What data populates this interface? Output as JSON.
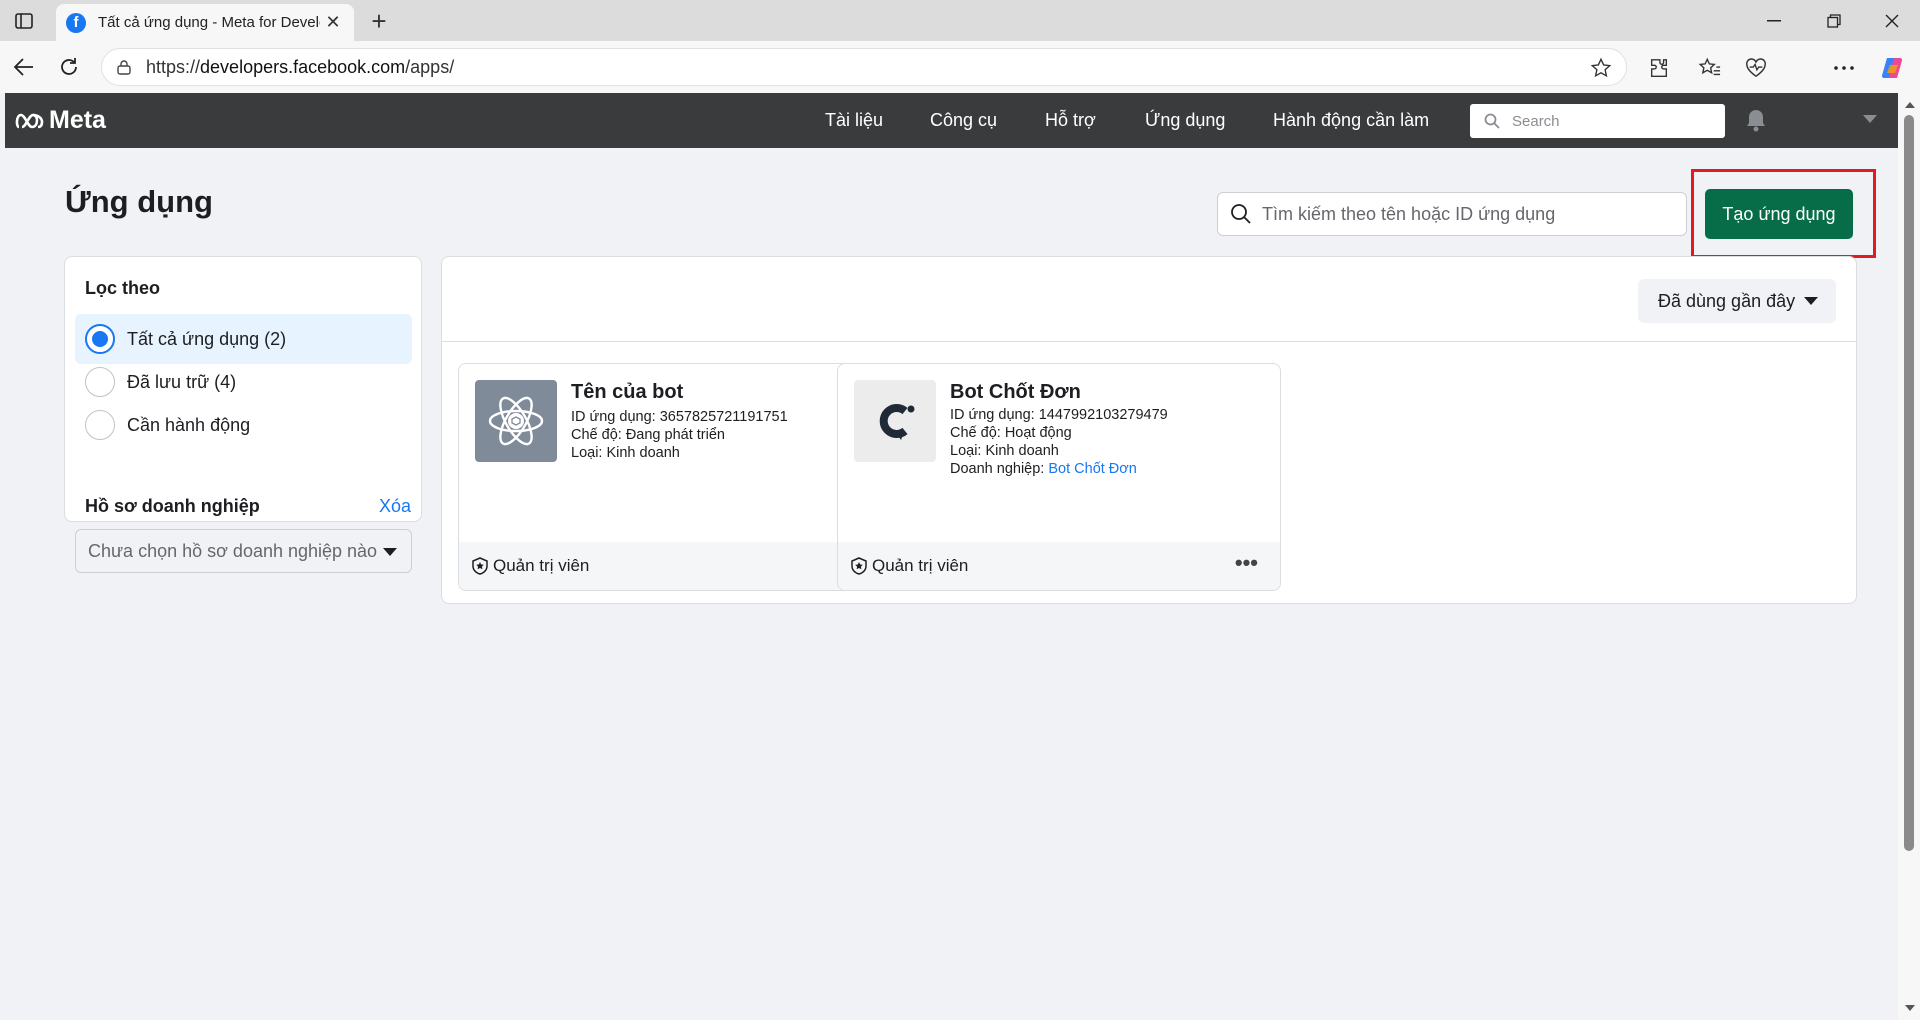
{
  "browser": {
    "tab_title": "Tất cả ứng dụng - Meta for Developers",
    "url_prefix": "https://",
    "url_host": "developers.facebook.com",
    "url_path": "/apps/"
  },
  "header": {
    "logo_text": "Meta",
    "nav": [
      "Tài liệu",
      "Công cụ",
      "Hỗ trợ",
      "Ứng dụng",
      "Hành động cần làm"
    ],
    "search_placeholder": "Search"
  },
  "page": {
    "title": "Ứng dụng",
    "search_placeholder": "Tìm kiếm theo tên hoặc ID ứng dụng",
    "create_button": "Tạo ứng dụng"
  },
  "filters": {
    "heading": "Lọc theo",
    "options": [
      "Tất cả ứng dụng (2)",
      "Đã lưu trữ (4)",
      "Cần hành động"
    ],
    "selected_index": 0,
    "business_heading": "Hồ sơ doanh nghiệp",
    "business_clear": "Xóa",
    "business_placeholder": "Chưa chọn hồ sơ doanh nghiệp nào"
  },
  "sort": {
    "label": "Đã dùng gần đây"
  },
  "apps": [
    {
      "name": "Tên của bot",
      "id_line": "ID ứng dụng: 3657825721191751",
      "mode_line": "Chế độ: Đang phát triển",
      "type_line": "Loại: Kinh doanh",
      "role": "Quản trị viên",
      "icon": "atom-icon"
    },
    {
      "name": "Bot Chốt Đơn",
      "id_line": "ID ứng dụng: 1447992103279479",
      "mode_line": "Chế độ: Hoạt động",
      "type_line": "Loại: Kinh doanh",
      "business_prefix": "Doanh nghiệp: ",
      "business_link": "Bot Chốt Đơn",
      "role": "Quản trị viên",
      "icon": "c-logo-icon"
    }
  ],
  "colors": {
    "create_button_bg": "#076c48",
    "highlight_border": "#e11b22",
    "accent": "#1877f2",
    "header_bg": "#3a3b3c"
  }
}
